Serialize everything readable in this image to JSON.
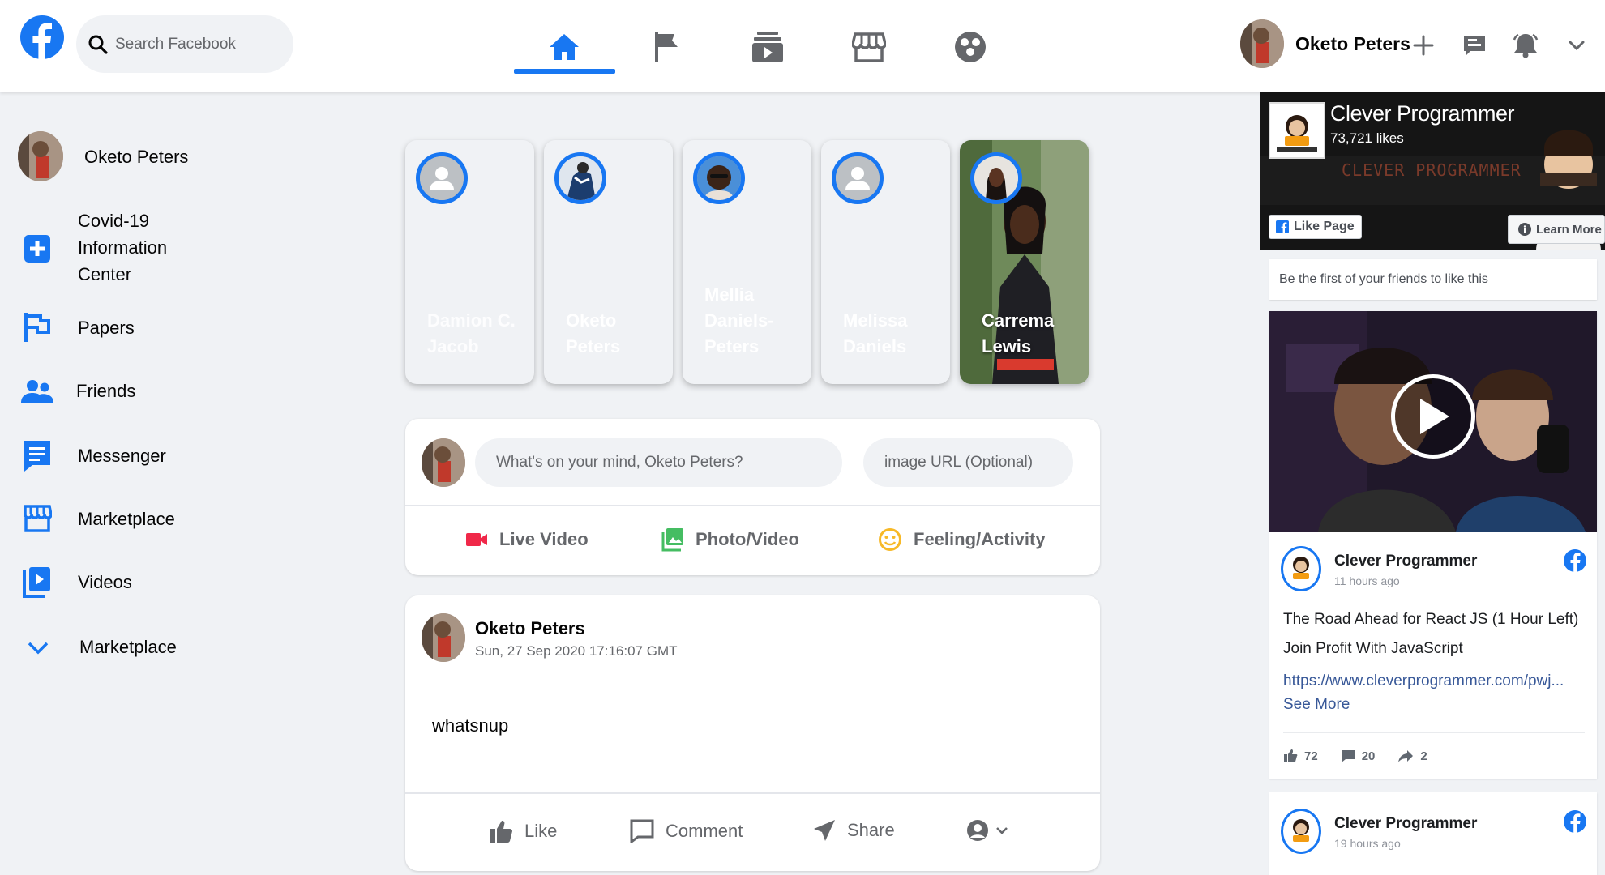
{
  "header": {
    "search_placeholder": "Search Facebook",
    "user_name": "Oketo Peters",
    "nav": [
      "home-icon",
      "flag-icon",
      "watch-icon",
      "marketplace-icon",
      "groups-icon"
    ],
    "right_icons": [
      "plus-icon",
      "messenger-icon",
      "bell-icon",
      "chevron-down-icon"
    ]
  },
  "sidebar": {
    "profile_name": "Oketo Peters",
    "items": [
      {
        "label_lines": [
          "Covid-19",
          "Information",
          "Center"
        ],
        "icon": "covid-center-icon"
      },
      {
        "label": "Papers",
        "icon": "flag-outline-icon"
      },
      {
        "label": "Friends",
        "icon": "friends-icon"
      },
      {
        "label": "Messenger",
        "icon": "messenger-icon"
      },
      {
        "label": "Marketplace",
        "icon": "marketplace-icon"
      },
      {
        "label": "Videos",
        "icon": "video-icon"
      },
      {
        "label": "Marketplace",
        "icon": "chevron-down-icon"
      }
    ]
  },
  "stories": [
    {
      "name_lines": [
        "Damion C.",
        "Jacob"
      ]
    },
    {
      "name_lines": [
        "Oketo Peters"
      ]
    },
    {
      "name_lines": [
        "Mellia",
        "Daniels-",
        "Peters"
      ]
    },
    {
      "name_lines": [
        "Melissa",
        "Daniels"
      ]
    },
    {
      "name_lines": [
        "Carrema",
        "Lewis"
      ]
    }
  ],
  "composer": {
    "placeholder": "What's on your mind, Oketo Peters?",
    "image_placeholder": "image URL (Optional)",
    "actions": [
      {
        "label": "Live Video",
        "icon": "live-video-icon",
        "color": "#f02849"
      },
      {
        "label": "Photo/Video",
        "icon": "photo-icon",
        "color": "#45bd62"
      },
      {
        "label": "Feeling/Activity",
        "icon": "feeling-icon",
        "color": "#f7b928"
      }
    ]
  },
  "post": {
    "author": "Oketo Peters",
    "timestamp": "Sun, 27 Sep 2020 17:16:07 GMT",
    "text": "whatsnup",
    "actions": {
      "like": "Like",
      "comment": "Comment",
      "share": "Share"
    }
  },
  "page_widget": {
    "banner_title": "Clever Programmer",
    "likes": "73,721 likes",
    "banner_watermark": "CLEVER PROGRAMMER",
    "like_page": "Like Page",
    "learn_more": "Learn More",
    "friends_note": "Be the first of your friends to like this",
    "posts": [
      {
        "author": "Clever Programmer",
        "time": "11 hours ago",
        "line1": "The Road Ahead for React JS (1 Hour Left)",
        "line2": "Join Profit With JavaScript",
        "link": "https://www.cleverprogrammer.com/pwj...",
        "see_more": "See More",
        "likes": "72",
        "comments": "20",
        "shares": "2"
      },
      {
        "author": "Clever Programmer",
        "time": "19 hours ago"
      }
    ]
  },
  "colors": {
    "brand": "#1877f2",
    "background": "#f0f2f5",
    "secondary_text": "#65676b"
  }
}
